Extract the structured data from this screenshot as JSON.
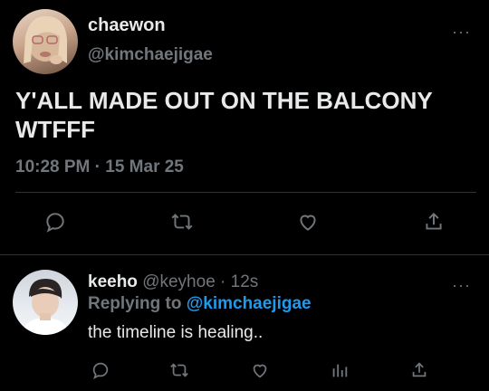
{
  "tweet": {
    "display_name": "chaewon",
    "handle": "@kimchaejigae",
    "text_line1": "Y'ALL MADE OUT ON THE BALCONY",
    "text_line2": "WTFFF",
    "timestamp": "10:28 PM · 15 Mar 25",
    "more_label": "···",
    "actions": [
      "reply-icon",
      "retweet-icon",
      "like-icon",
      "share-icon"
    ]
  },
  "reply": {
    "display_name": "keeho",
    "handle": "@keyhoe",
    "time": "· 12s",
    "replying_prefix": "Replying to",
    "replying_handle": "@kimchaejigae",
    "text": "the timeline is healing..",
    "more_label": "···",
    "actions": [
      "reply-icon",
      "retweet-icon",
      "like-icon",
      "analytics-icon",
      "share-icon"
    ]
  },
  "colors": {
    "background": "#000000",
    "text": "#e7e9ea",
    "muted": "#71767b",
    "link": "#1d9bf0",
    "divider": "#2f3336"
  }
}
